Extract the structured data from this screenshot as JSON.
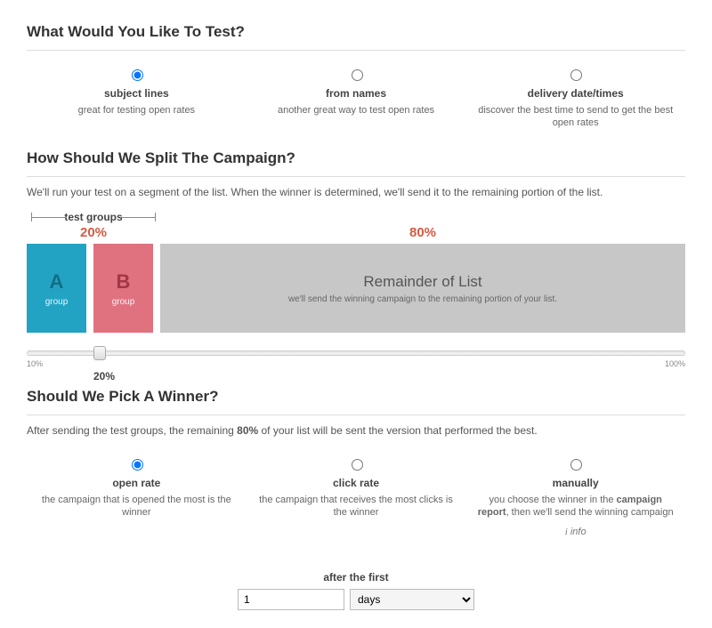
{
  "test": {
    "title": "What Would You Like To Test?",
    "options": [
      {
        "label": "subject lines",
        "desc": "great for testing open rates",
        "selected": true
      },
      {
        "label": "from names",
        "desc": "another great way to test open rates",
        "selected": false
      },
      {
        "label": "delivery date/times",
        "desc": "discover the best time to send to get the best open rates",
        "selected": false
      }
    ]
  },
  "split": {
    "title": "How Should We Split The Campaign?",
    "subtitle": "We'll run your test on a segment of the list. When the winner is determined, we'll send it to the remaining portion of the list.",
    "test_groups_label": "test groups",
    "pct_test": "20%",
    "pct_remainder": "80%",
    "groupA": {
      "letter": "A",
      "label": "group"
    },
    "groupB": {
      "letter": "B",
      "label": "group"
    },
    "remainder_title": "Remainder of List",
    "remainder_desc": "we'll send the winning campaign to the remaining portion of your list.",
    "slider": {
      "min_label": "10%",
      "max_label": "100%",
      "value_label": "20%"
    }
  },
  "winner": {
    "title": "Should We Pick A Winner?",
    "subtitle_before": "After sending the test groups, the remaining ",
    "subtitle_bold": "80%",
    "subtitle_after": " of your list will be sent the version that performed the best.",
    "options": [
      {
        "label": "open rate",
        "desc": "the campaign that is opened the most is the winner",
        "selected": true
      },
      {
        "label": "click rate",
        "desc": "the campaign that receives the most clicks is the winner",
        "selected": false
      },
      {
        "label": "manually",
        "desc_before": "you choose the winner in the ",
        "desc_bold": "campaign report",
        "desc_after": ", then we'll send the winning campaign",
        "selected": false
      }
    ],
    "info_icon": "i",
    "info_label": "info",
    "after_label": "after the first",
    "qty_value": "1",
    "unit_value": "days"
  }
}
